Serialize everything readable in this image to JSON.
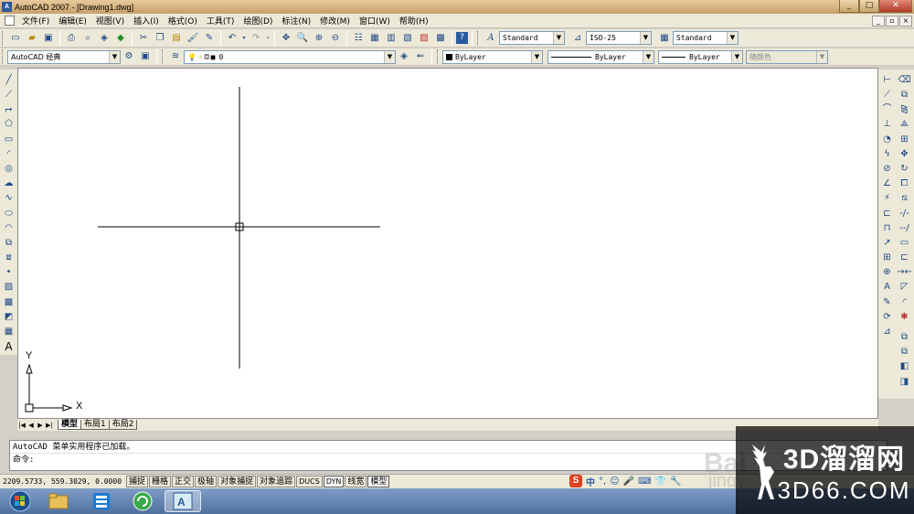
{
  "window": {
    "title": "AutoCAD 2007 - [Drawing1.dwg]",
    "app_icon_text": "A",
    "buttons": {
      "minimize": "_",
      "restore": "□",
      "close": "✕"
    }
  },
  "menubar": {
    "items": [
      "文件(F)",
      "编辑(E)",
      "视图(V)",
      "插入(I)",
      "格式(O)",
      "工具(T)",
      "绘图(D)",
      "标注(N)",
      "修改(M)",
      "窗口(W)",
      "帮助(H)"
    ],
    "mdi_buttons": {
      "minimize": "_",
      "restore": "▫",
      "close": "×"
    }
  },
  "styles_toolbar": {
    "text_style": "Standard",
    "dim_style": "ISO-25",
    "table_style": "Standard"
  },
  "workspace_toolbar": {
    "workspace": "AutoCAD 经典",
    "layer": "0",
    "color": "ByLayer",
    "linetype": "ByLayer",
    "lineweight": "ByLayer",
    "plotstyle": "随颜色"
  },
  "ucs": {
    "x_label": "X",
    "y_label": "Y"
  },
  "layout_tabs": {
    "nav": [
      "|◀",
      "◀",
      "▶",
      "▶|"
    ],
    "tabs": [
      "模型",
      "布局1",
      "布局2"
    ],
    "active": "模型"
  },
  "command": {
    "history": "AutoCAD 菜单实用程序已加载。",
    "prompt": "命令:"
  },
  "statusbar": {
    "coords": "2209.5733, 559.3029, 0.0000",
    "buttons": [
      {
        "label": "捕捉",
        "on": false
      },
      {
        "label": "栅格",
        "on": false
      },
      {
        "label": "正交",
        "on": false
      },
      {
        "label": "极轴",
        "on": false
      },
      {
        "label": "对象捕捉",
        "on": false
      },
      {
        "label": "对象追踪",
        "on": false
      },
      {
        "label": "DUCS",
        "on": false
      },
      {
        "label": "DYN",
        "on": true
      },
      {
        "label": "线宽",
        "on": false
      },
      {
        "label": "模型",
        "on": true
      }
    ]
  },
  "ime": {
    "logo": "S",
    "lang": "中",
    "punct": "°,",
    "emoji": "☺",
    "mic": "🎤",
    "keyboard": "⌨",
    "skin": "👕",
    "tools": "🔧"
  },
  "watermark": {
    "line1": "3D溜溜网",
    "line2": "3D66.COM",
    "baidu": "Bai",
    "jy": "jingy"
  },
  "colors": {
    "titlebar": "#d8b684",
    "menu": "#ece9d8",
    "canvas": "#ffffff",
    "taskbar": "#5a7aa8"
  }
}
